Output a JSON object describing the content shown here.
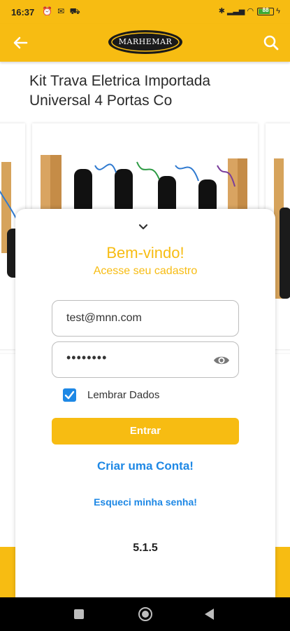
{
  "status_bar": {
    "time": "16:37",
    "battery": "88"
  },
  "app_bar": {
    "logo_text": "MARHEMAR",
    "back_icon": "arrow-left-icon",
    "search_icon": "search-icon"
  },
  "product": {
    "title": "Kit Trava Eletrica Importada Universal 4 Portas Co"
  },
  "login": {
    "welcome": "Bem-vindo!",
    "subtitle": "Acesse seu cadastro",
    "email_value": "test@mnn.com",
    "password_value": "••••••••",
    "remember_label": "Lembrar Dados",
    "remember_checked": true,
    "enter_label": "Entrar",
    "create_account": "Criar uma Conta!",
    "forgot_password": "Esqueci minha senha!",
    "version": "5.1.5"
  },
  "colors": {
    "brand": "#f7bc12",
    "link": "#1e88e5"
  }
}
